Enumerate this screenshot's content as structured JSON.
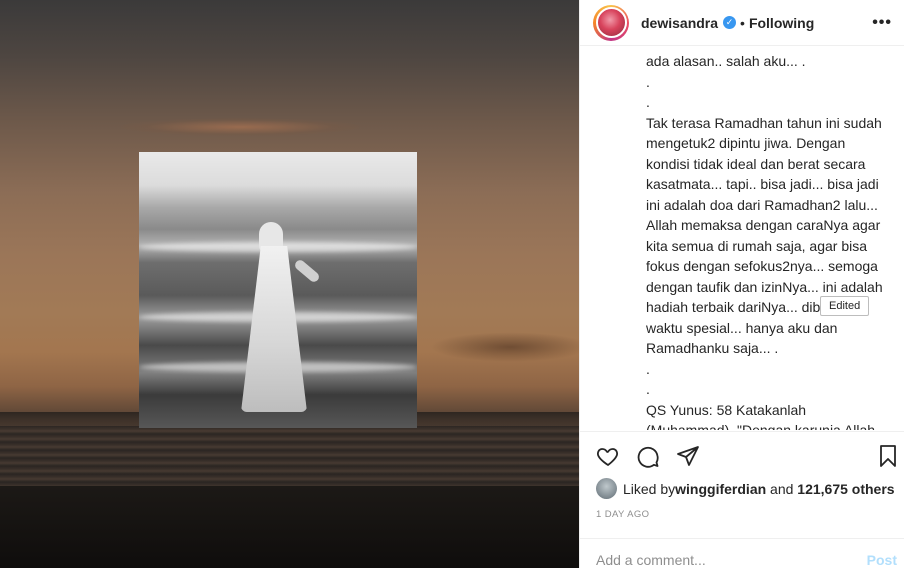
{
  "post": {
    "image": {
      "inset_photo": "black-and-white woman on beach"
    }
  },
  "header": {
    "username": "dewisandra",
    "verified_icon": "✓",
    "separator": "•",
    "follow_status": "Following",
    "more_icon": "•••"
  },
  "caption": {
    "text": "ada alasan.. salah aku... .\n.\n.\nTak terasa Ramadhan tahun ini sudah mengetuk2 dipintu jiwa. Dengan kondisi tidak ideal dan berat secara kasatmata... tapi.. bisa jadi... bisa jadi ini adalah doa dari Ramadhan2 lalu... Allah memaksa dengan caraNya agar kita semua di rumah saja, agar bisa fokus dengan sefokus2nya... semoga dengan taufik dan izinNya... ini adalah hadiah terbaik dariNya... diberikan waktu spesial... hanya aku dan Ramadhanku saja... .\n.\n.\nQS Yunus: 58 Katakanlah (Muhammad), \"Dengan karunia Allah dan rahmatNya, hendaklah dengan itu mereka bergembira itu lebih baik",
    "edited_label": "Edited"
  },
  "actions": {
    "like_icon": "heart-icon",
    "comment_icon": "comment-icon",
    "share_icon": "share-icon",
    "save_icon": "bookmark-icon"
  },
  "likes": {
    "prefix": "Liked by ",
    "user": "winggiferdian",
    "middle": " and ",
    "count": "121,675 others"
  },
  "timestamp": "1 DAY AGO",
  "comment": {
    "placeholder": "Add a comment...",
    "post_label": "Post"
  }
}
